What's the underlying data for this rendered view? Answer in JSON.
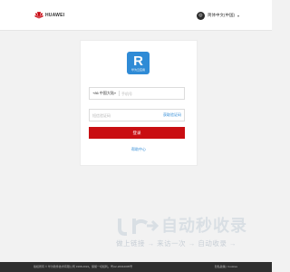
{
  "header": {
    "logo_text": "HUAWEI",
    "language_label": "简体中文(中国)",
    "language_icon": "globe-icon"
  },
  "card": {
    "app_logo_letter": "R",
    "app_logo_subtitle": "华为云应用",
    "country_code": "+86 中国大陆",
    "phone_placeholder": "手机号",
    "code_placeholder": "短信验证码",
    "get_code_label": "获取验证码",
    "login_label": "登录",
    "help_label": "帮助中心"
  },
  "watermark": {
    "title": "自动秒收录",
    "slogan": "做上链接 → 来访一次 → 自动收录 →"
  },
  "footer": {
    "copyright": "版权所有 © 华为软件技术有限公司 1998-2024。保留一切权利。粤A2-20044005号",
    "links": "隐私政策 | Cookies"
  },
  "colors": {
    "accent": "#c90e12",
    "link": "#2f8bd6",
    "footer_bg": "#2f2f2f",
    "page_bg": "#f2f2f2"
  }
}
